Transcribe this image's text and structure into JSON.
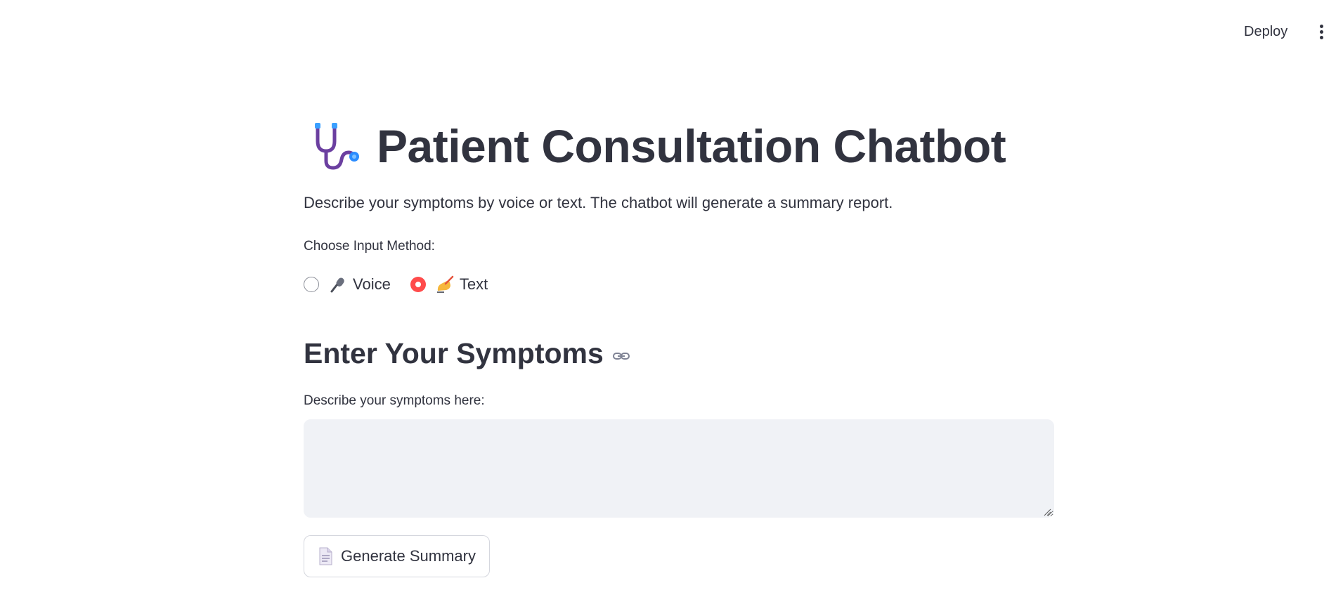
{
  "toolbar": {
    "deploy_label": "Deploy",
    "menu_icon": "vertical-ellipsis-icon"
  },
  "header": {
    "title_icon": "stethoscope-icon",
    "title": "Patient Consultation Chatbot",
    "subtitle": "Describe your symptoms by voice or text. The chatbot will generate a summary report."
  },
  "input_method": {
    "label": "Choose Input Method:",
    "options": [
      {
        "icon": "microphone-icon",
        "label": "Voice",
        "selected": false
      },
      {
        "icon": "writing-hand-icon",
        "label": "Text",
        "selected": true
      }
    ]
  },
  "symptoms_section": {
    "heading": "Enter Your Symptoms",
    "heading_icon": "link-icon",
    "textarea_label": "Describe your symptoms here:",
    "textarea_value": "",
    "textarea_placeholder": ""
  },
  "generate": {
    "icon": "document-icon",
    "label": "Generate Summary"
  },
  "colors": {
    "accent": "#ff4b4b",
    "text": "#31333f",
    "input_bg": "#f0f2f6",
    "border": "#d5d7de"
  }
}
